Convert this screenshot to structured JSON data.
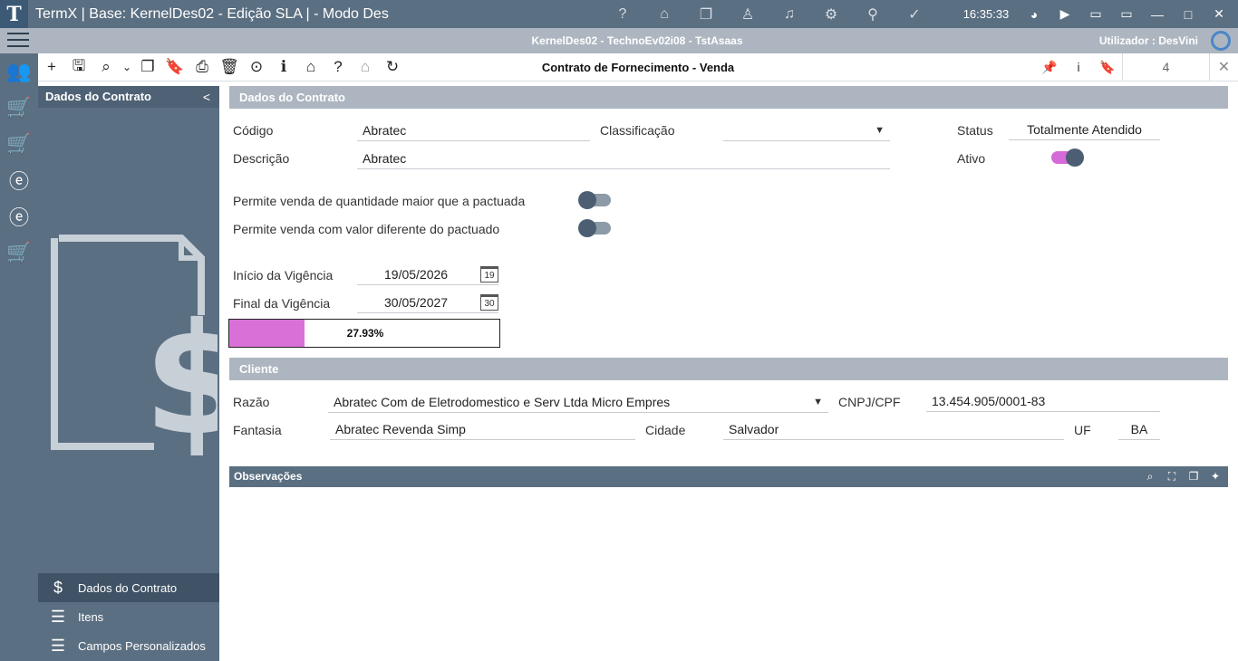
{
  "window": {
    "title": "TermX | Base: KernelDes02 - Edição SLA | - Modo Des",
    "logo_letter": "T",
    "clock": "16:35:33",
    "title_icons": [
      "help-icon",
      "bank-icon",
      "windows-icon",
      "user-icon",
      "bell-icon",
      "gear-icon",
      "chat-icon",
      "check-icon"
    ],
    "title_glyphs": [
      "?",
      "⌂",
      "❐",
      "♙",
      "♫",
      "⚙",
      "⚲",
      "✓"
    ],
    "window_glyphs": [
      "◕",
      "▶",
      "▭",
      "▭",
      "—",
      "□",
      "✕"
    ]
  },
  "infobar": {
    "context": "KernelDes02 - TechnoEv02i08 - TstAsaas",
    "user_label": "Utilizador :",
    "user_name": "DesVini"
  },
  "toolbar": {
    "document_title": "Contrato de Fornecimento - Venda",
    "glyphs": [
      "+",
      "🖫",
      "⌕",
      "⌄",
      "❐",
      "🔖",
      "⎙",
      "🗑",
      "⊙",
      "ℹ",
      "⌂",
      "?",
      "⌂",
      "↻"
    ],
    "record_count": "4",
    "info": "i"
  },
  "sidebar": {
    "header": "Dados do Contrato",
    "collapse": "<",
    "nav": [
      {
        "label": "Dados do Contrato",
        "icon": "$"
      },
      {
        "label": "Itens",
        "icon": "☰"
      },
      {
        "label": "Campos Personalizados",
        "icon": "☰"
      }
    ]
  },
  "section_contrato": {
    "title": "Dados do Contrato",
    "codigo_label": "Código",
    "codigo_value": "Abratec",
    "classificacao_label": "Classificação",
    "classificacao_value": "",
    "status_label": "Status",
    "status_value": "Totalmente Atendido",
    "descricao_label": "Descrição",
    "descricao_value": "Abratec",
    "ativo_label": "Ativo",
    "ativo": true,
    "perm_qtd_label": "Permite venda de quantidade maior que a pactuada",
    "perm_qtd": false,
    "perm_valor_label": "Permite venda com valor diferente do pactuado",
    "perm_valor": false,
    "inicio_label": "Início da Vigência",
    "inicio_value": "19/05/2026",
    "inicio_cal": "19",
    "final_label": "Final da Vigência",
    "final_value": "30/05/2027",
    "final_cal": "30",
    "progress": 0.2793,
    "progress_text": "27.93%"
  },
  "section_cliente": {
    "title": "Cliente",
    "razao_label": "Razão",
    "razao_value": "Abratec Com de Eletrodomestico e Serv Ltda Micro Empres",
    "cnpj_label": "CNPJ/CPF",
    "cnpj_value": "13.454.905/0001-83",
    "fantasia_label": "Fantasia",
    "fantasia_value": "Abratec Revenda Simp",
    "cidade_label": "Cidade",
    "cidade_value": "Salvador",
    "uf_label": "UF",
    "uf_value": "BA"
  },
  "observacoes": {
    "title": "Observações"
  },
  "colors": {
    "accent_pink": "#d970d7",
    "bar_dark": "#5b6f82",
    "section_grey": "#adb6c0"
  }
}
